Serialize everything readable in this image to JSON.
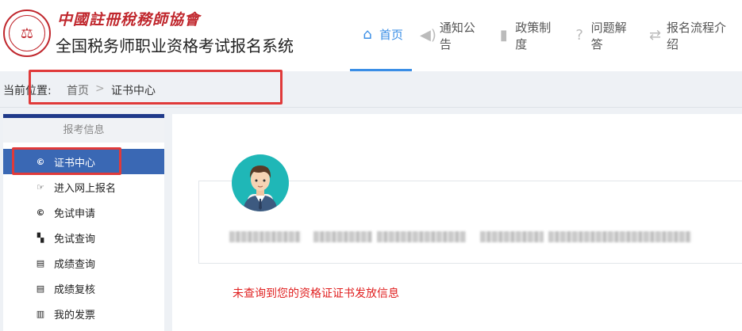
{
  "header": {
    "logo_calligraphy": "中國註冊稅務師協會",
    "system_name": "全国税务师职业资格考试报名系统"
  },
  "nav": [
    {
      "label": "首页",
      "icon": "home-icon",
      "active": true
    },
    {
      "label": "通知公告",
      "icon": "speaker-icon",
      "active": false
    },
    {
      "label": "政策制度",
      "icon": "book-icon",
      "active": false
    },
    {
      "label": "问题解答",
      "icon": "question-icon",
      "active": false
    },
    {
      "label": "报名流程介绍",
      "icon": "refresh-icon",
      "active": false
    }
  ],
  "breadcrumb": {
    "label": "当前位置:",
    "home": "首页",
    "separator": ">",
    "current": "证书中心"
  },
  "sidebar": {
    "header": "报考信息",
    "items": [
      {
        "label": "证书中心",
        "icon": "copyright-icon",
        "active": true
      },
      {
        "label": "进入网上报名",
        "icon": "hand-point-icon",
        "active": false
      },
      {
        "label": "免试申请",
        "icon": "copyright-icon",
        "active": false
      },
      {
        "label": "免试查询",
        "icon": "files-icon",
        "active": false
      },
      {
        "label": "成绩查询",
        "icon": "list-icon",
        "active": false
      },
      {
        "label": "成绩复核",
        "icon": "list-icon",
        "active": false
      },
      {
        "label": "我的发票",
        "icon": "barcode-icon",
        "active": false
      }
    ]
  },
  "main": {
    "message": "未查询到您的资格证证书发放信息"
  },
  "colors": {
    "accent": "#3a8ee6",
    "sidebar_active": "#3a68b4",
    "highlight_box": "#e03a3a",
    "message": "#e02020",
    "avatar_bg": "#1fb7b7"
  }
}
